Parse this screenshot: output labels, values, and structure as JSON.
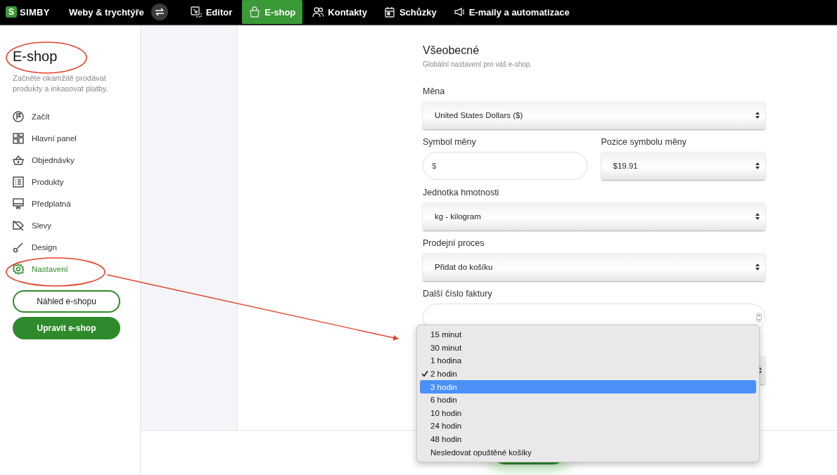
{
  "topbar": {
    "logo_mark": "S",
    "logo_text": "SIMBY",
    "site": "Weby & trychtýře",
    "tabs": [
      {
        "label": "Editor",
        "selected": false
      },
      {
        "label": "E-shop",
        "selected": true
      },
      {
        "label": "Kontakty",
        "selected": false
      },
      {
        "label": "Schůzky",
        "selected": false
      },
      {
        "label": "E-maily a automatizace",
        "selected": false
      }
    ]
  },
  "sidebar": {
    "title": "E-shop",
    "subtitle": "Začněte okamžitě prodávat produkty a inkasovat platby.",
    "items": [
      {
        "label": "Začít",
        "selected": false
      },
      {
        "label": "Hlavní panel",
        "selected": false
      },
      {
        "label": "Objednávky",
        "selected": false
      },
      {
        "label": "Produkty",
        "selected": false
      },
      {
        "label": "Předplatná",
        "selected": false
      },
      {
        "label": "Slevy",
        "selected": false
      },
      {
        "label": "Design",
        "selected": false
      },
      {
        "label": "Nastavení",
        "selected": true
      }
    ],
    "buttons": [
      {
        "label": "Náhled e-shopu",
        "kind": "outline"
      },
      {
        "label": "Upravit e-shop",
        "kind": "filled"
      }
    ]
  },
  "form": {
    "title": "Všeobecné",
    "subtitle": "Globální nastavení pro váš e-shop.",
    "fields": [
      {
        "label": "Měna",
        "kind": "select",
        "value": "United States Dollars ($)"
      },
      {
        "kind": "pair",
        "items": [
          {
            "label": "Symbol měny",
            "kind": "input",
            "value": "$"
          },
          {
            "label": "Pozice symbolu měny",
            "kind": "select",
            "value": "$19.91"
          }
        ]
      },
      {
        "label": "Jednotka hmotnosti",
        "kind": "select",
        "value": "kg - kilogram"
      },
      {
        "label": "Prodejní proces",
        "kind": "select",
        "value": "Přidat do košíku"
      },
      {
        "label": "Další číslo faktury",
        "kind": "number"
      },
      {
        "kind": "hidden-select"
      }
    ]
  },
  "dropdown": {
    "options": [
      {
        "label": "15 minut",
        "checked": false,
        "selected": false
      },
      {
        "label": "30 minut",
        "checked": false,
        "selected": false
      },
      {
        "label": "1 hodina",
        "checked": false,
        "selected": false
      },
      {
        "label": "2 hodin",
        "checked": true,
        "selected": false
      },
      {
        "label": "3 hodin",
        "checked": false,
        "selected": true
      },
      {
        "label": "6 hodin",
        "checked": false,
        "selected": false
      },
      {
        "label": "10 hodin",
        "checked": false,
        "selected": false
      },
      {
        "label": "24 hodin",
        "checked": false,
        "selected": false
      },
      {
        "label": "48 hodin",
        "checked": false,
        "selected": false
      },
      {
        "label": "Nesledovat opuštěné košíky",
        "checked": false,
        "selected": false
      }
    ]
  }
}
